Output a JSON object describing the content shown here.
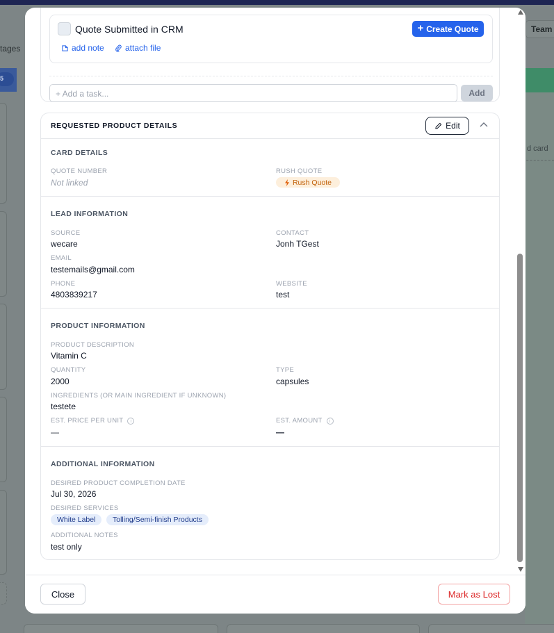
{
  "background": {
    "left_partial_label": "tages",
    "left_partial_badge": "5",
    "team_button": "Team",
    "add_card_partial": "d card"
  },
  "tasks": {
    "item_title": "Quote Submitted in CRM",
    "create_quote_label": "Create Quote",
    "add_note_label": "add note",
    "attach_file_label": "attach file",
    "new_task_placeholder": "+ Add a task...",
    "add_button": "Add"
  },
  "details": {
    "title": "REQUESTED PRODUCT DETAILS",
    "edit_label": "Edit",
    "card_details": {
      "title": "CARD DETAILS",
      "quote_number_label": "QUOTE NUMBER",
      "quote_number_value": "Not linked",
      "rush_quote_label": "RUSH QUOTE",
      "rush_quote_badge": "Rush Quote"
    },
    "lead_information": {
      "title": "LEAD INFORMATION",
      "source_label": "SOURCE",
      "source_value": "wecare",
      "contact_label": "CONTACT",
      "contact_value": "Jonh TGest",
      "email_label": "EMAIL",
      "email_value": "testemails@gmail.com",
      "phone_label": "PHONE",
      "phone_value": "4803839217",
      "website_label": "WEBSITE",
      "website_value": "test"
    },
    "product_information": {
      "title": "PRODUCT INFORMATION",
      "description_label": "PRODUCT DESCRIPTION",
      "description_value": "Vitamin C",
      "quantity_label": "QUANTITY",
      "quantity_value": "2000",
      "type_label": "TYPE",
      "type_value": "capsules",
      "ingredients_label": "INGREDIENTS (OR MAIN INGREDIENT IF UNKNOWN)",
      "ingredients_value": "testete",
      "price_label": "EST. PRICE PER UNIT",
      "price_value": "—",
      "amount_label": "EST. AMOUNT",
      "amount_value": "—"
    },
    "additional_information": {
      "title": "ADDITIONAL INFORMATION",
      "completion_date_label": "DESIRED PRODUCT COMPLETION DATE",
      "completion_date_value": "Jul 30, 2026",
      "services_label": "DESIRED SERVICES",
      "services": [
        "White Label",
        "Tolling/Semi-finish Products"
      ],
      "notes_label": "ADDITIONAL NOTES",
      "notes_value": "test only"
    }
  },
  "footer": {
    "close_label": "Close",
    "mark_lost_label": "Mark as Lost"
  },
  "colors": {
    "primary": "#2563eb",
    "danger": "#dc2626",
    "rush_bg": "#fdefdc",
    "rush_text": "#c2620c",
    "tag_bg": "#e5edfb"
  }
}
